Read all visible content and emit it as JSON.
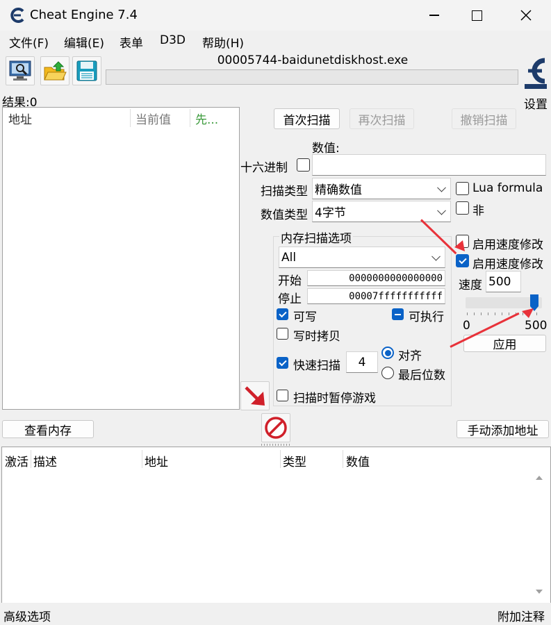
{
  "window": {
    "title": "Cheat Engine 7.4"
  },
  "menu": [
    "文件(F)",
    "编辑(E)",
    "表单",
    "D3D",
    "帮助(H)"
  ],
  "process_name": "00005744-baidunetdiskhost.exe",
  "settings_label": "设置",
  "results_label": "结果:0",
  "results_columns": [
    "地址",
    "当前值",
    "先..."
  ],
  "scan_buttons": {
    "first": "首次扫描",
    "next": "再次扫描",
    "undo": "撤销扫描"
  },
  "value_label": "数值:",
  "hex_label": "十六进制",
  "scan_type_label": "扫描类型",
  "scan_type_value": "精确数值",
  "value_type_label": "数值类型",
  "value_type_value": "4字节",
  "lua_formula": "Lua formula",
  "not_label": "非",
  "mem_options_title": "内存扫描选项",
  "region_value": "All",
  "start_label": "开始",
  "start_value": "0000000000000000",
  "stop_label": "停止",
  "stop_value": "00007fffffffffff",
  "writable": "可写",
  "executable": "可执行",
  "copy_on_write": "写时拷贝",
  "fast_scan": "快速扫描",
  "fast_scan_value": "4",
  "align": "对齐",
  "last_digits": "最后位数",
  "pause_game": "扫描时暂停游戏",
  "speedhack_1": "启用速度修改",
  "speedhack_2": "启用速度修改",
  "speed_label": "速度",
  "speed_value": "500",
  "slider": {
    "min": "0",
    "max": "500",
    "value": 500
  },
  "apply": "应用",
  "view_memory": "查看内存",
  "add_address": "手动添加地址",
  "address_columns": [
    "激活",
    "描述",
    "地址",
    "类型",
    "数值"
  ],
  "advanced_options": "高级选项",
  "table_extras": "附加注释",
  "colors": {
    "accent": "#0a62c7",
    "arrow": "#e8323a",
    "stop": "#d0202a"
  }
}
